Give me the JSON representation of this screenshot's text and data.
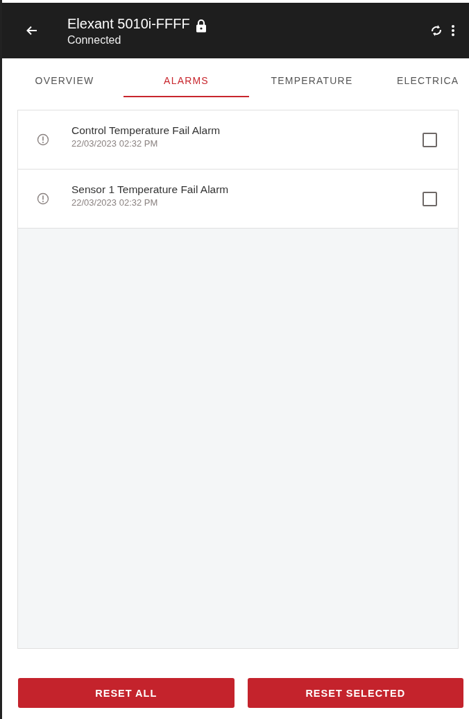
{
  "app_bar": {
    "title": "Elexant 5010i-FFFF",
    "locked": true,
    "subtitle": "Connected"
  },
  "tabs": [
    {
      "label": "OVERVIEW",
      "selected": false
    },
    {
      "label": "ALARMS",
      "selected": true
    },
    {
      "label": "TEMPERATURE",
      "selected": false
    },
    {
      "label": "ELECTRICA",
      "selected": false
    }
  ],
  "alarms": [
    {
      "name": "Control Temperature Fail Alarm",
      "time": "22/03/2023 02:32 PM",
      "checked": false
    },
    {
      "name": "Sensor 1 Temperature Fail Alarm",
      "time": "22/03/2023 02:32 PM",
      "checked": false
    }
  ],
  "buttons": [
    {
      "label": "RESET ALL"
    },
    {
      "label": "RESET SELECTED"
    }
  ]
}
